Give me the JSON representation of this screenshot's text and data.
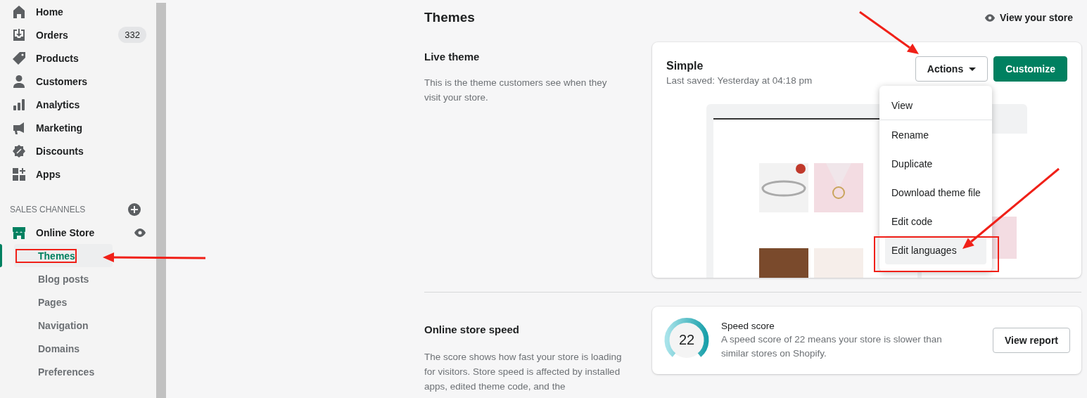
{
  "sidebar": {
    "items": [
      {
        "label": "Home"
      },
      {
        "label": "Orders",
        "badge": "332"
      },
      {
        "label": "Products"
      },
      {
        "label": "Customers"
      },
      {
        "label": "Analytics"
      },
      {
        "label": "Marketing"
      },
      {
        "label": "Discounts"
      },
      {
        "label": "Apps"
      }
    ],
    "sales_channels": {
      "heading": "SALES CHANNELS",
      "channel": {
        "label": "Online Store",
        "children": [
          {
            "label": "Themes",
            "selected": true
          },
          {
            "label": "Blog posts",
            "selected": false
          },
          {
            "label": "Pages",
            "selected": false
          },
          {
            "label": "Navigation",
            "selected": false
          },
          {
            "label": "Domains",
            "selected": false
          },
          {
            "label": "Preferences",
            "selected": false
          }
        ]
      }
    }
  },
  "header": {
    "title": "Themes",
    "view_store": "View your store"
  },
  "live_theme": {
    "title": "Live theme",
    "description": "This is the theme customers see when they visit your store.",
    "card": {
      "name": "Simple",
      "saved": "Last saved: Yesterday at 04:18 pm",
      "actions": "Actions",
      "customize": "Customize"
    },
    "menu": [
      {
        "label": "View",
        "highlighted": false,
        "separated": true
      },
      {
        "label": "Rename",
        "highlighted": false,
        "separated": false
      },
      {
        "label": "Duplicate",
        "highlighted": false,
        "separated": false
      },
      {
        "label": "Download theme file",
        "highlighted": false,
        "separated": false
      },
      {
        "label": "Edit code",
        "highlighted": false,
        "separated": false
      },
      {
        "label": "Edit languages",
        "highlighted": true,
        "separated": false
      }
    ]
  },
  "speed": {
    "title": "Online store speed",
    "description": "The score shows how fast your store is loading for visitors. Store speed is affected by installed apps, edited theme code, and the",
    "card": {
      "score": "22",
      "heading": "Speed score",
      "text": "A speed score of 22 means your store is slower than similar stores on Shopify.",
      "button": "View report"
    }
  }
}
